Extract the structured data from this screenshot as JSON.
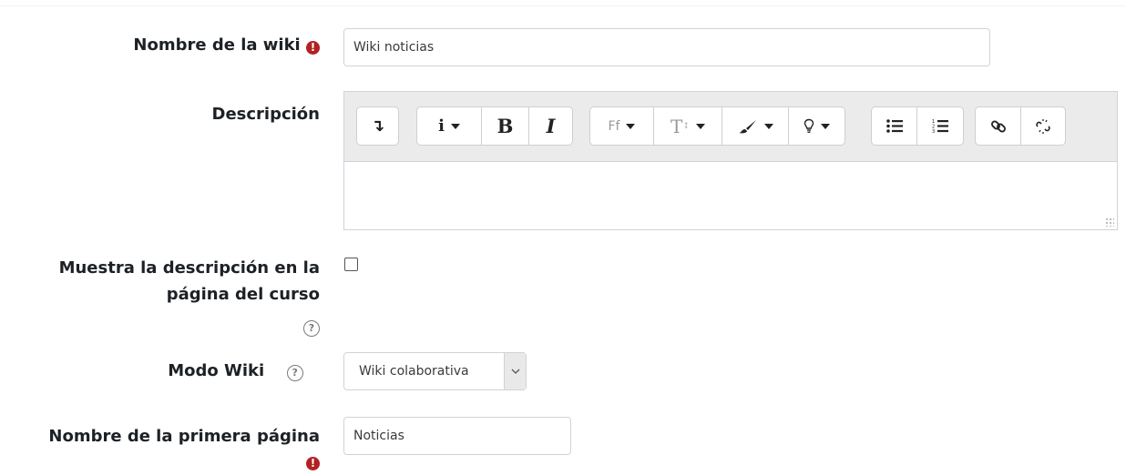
{
  "fields": {
    "wiki_name": {
      "label": "Nombre de la wiki",
      "value": "Wiki noticias",
      "required_icon": "exclamation-circle-icon"
    },
    "description": {
      "label": "Descripción",
      "value": "",
      "toolbar": {
        "collapse": "↴",
        "info": "i",
        "bold": "B",
        "italic": "I",
        "font_family": "Ff",
        "font_size": "T",
        "color": "paintbrush-icon",
        "background": "lightbulb-icon",
        "unordered_list": "unordered-list-icon",
        "ordered_list": "ordered-list-icon",
        "link": "link-icon",
        "unlink": "unlink-icon"
      }
    },
    "show_description": {
      "label_line1": "Muestra la descripción en la",
      "label_line2": "página del curso",
      "checked": false,
      "help_icon": "question-circle-icon"
    },
    "wiki_mode": {
      "label": "Modo Wiki",
      "selected": "Wiki colaborativa",
      "help_icon": "question-circle-icon"
    },
    "first_page_name": {
      "label": "Nombre de la primera página",
      "value": "Noticias",
      "required_icon": "exclamation-circle-icon"
    }
  },
  "glyphs": {
    "required": "!",
    "help": "?"
  },
  "colors": {
    "required": "#b22222",
    "toolbar_bg": "#ebebeb",
    "label": "#1d2125"
  }
}
